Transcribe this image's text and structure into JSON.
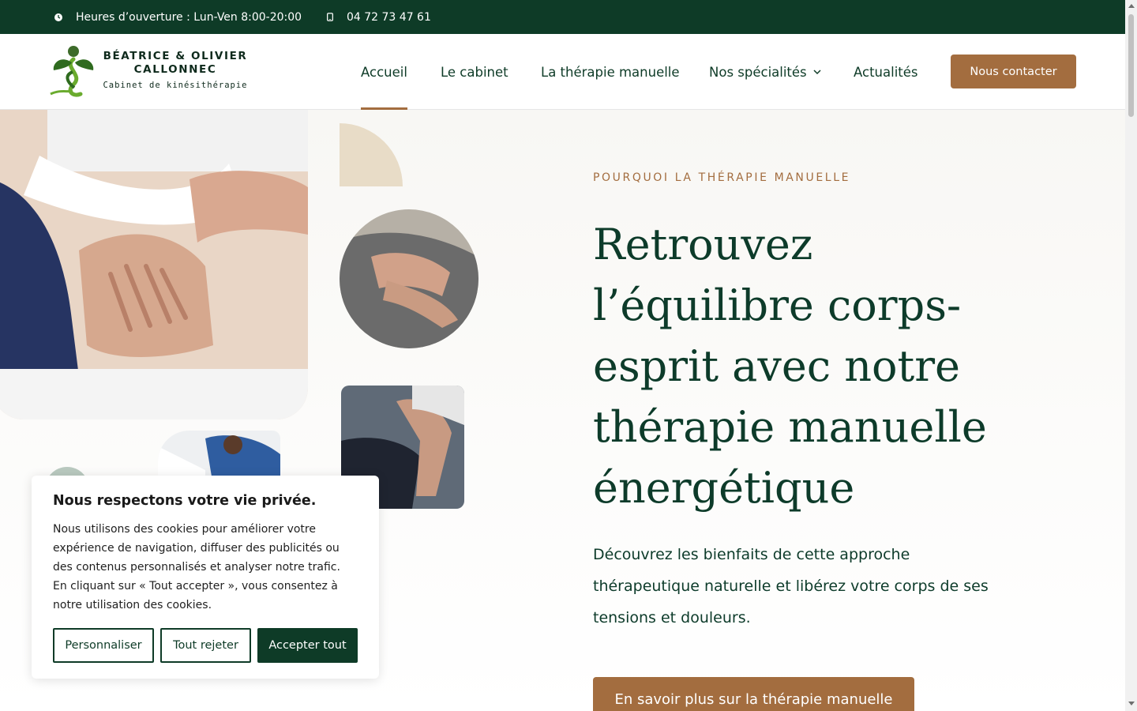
{
  "topbar": {
    "hours": "Heures d’ouverture : Lun-Ven 8:00-20:00",
    "phone": "04 72 73 47 61"
  },
  "logo": {
    "name_line1": "BÉATRICE & OLIVIER",
    "name_line2": "CALLONNEC",
    "subtitle": "Cabinet de kinésithérapie"
  },
  "nav": {
    "items": [
      {
        "label": "Accueil"
      },
      {
        "label": "Le cabinet"
      },
      {
        "label": "La thérapie manuelle"
      },
      {
        "label": "Nos spécialités"
      },
      {
        "label": "Actualités"
      }
    ],
    "contact_label": "Nous contacter"
  },
  "hero": {
    "eyebrow": "POURQUOI LA THÉRAPIE MANUELLE",
    "title": "Retrouvez l’équilibre corps-esprit avec notre thérapie manuelle énergétique",
    "lead": "Découvrez les bienfaits de cette approche thérapeutique naturelle et libérez votre corps de ses tensions et douleurs.",
    "cta_label": "En savoir plus sur la thérapie manuelle"
  },
  "cookie": {
    "title": "Nous respectons votre vie privée.",
    "text": "Nous utilisons des cookies pour améliorer votre expérience de navigation, diffuser des publicités ou des contenus personnalisés et analyser notre trafic. En cliquant sur « Tout accepter », vous consentez à notre utilisation des cookies.",
    "customize_label": "Personnaliser",
    "reject_label": "Tout rejeter",
    "accept_label": "Accepter tout"
  },
  "colors": {
    "dark_green": "#0e3b27",
    "accent_brown": "#a36d3f",
    "beige": "#e8dcc7"
  }
}
